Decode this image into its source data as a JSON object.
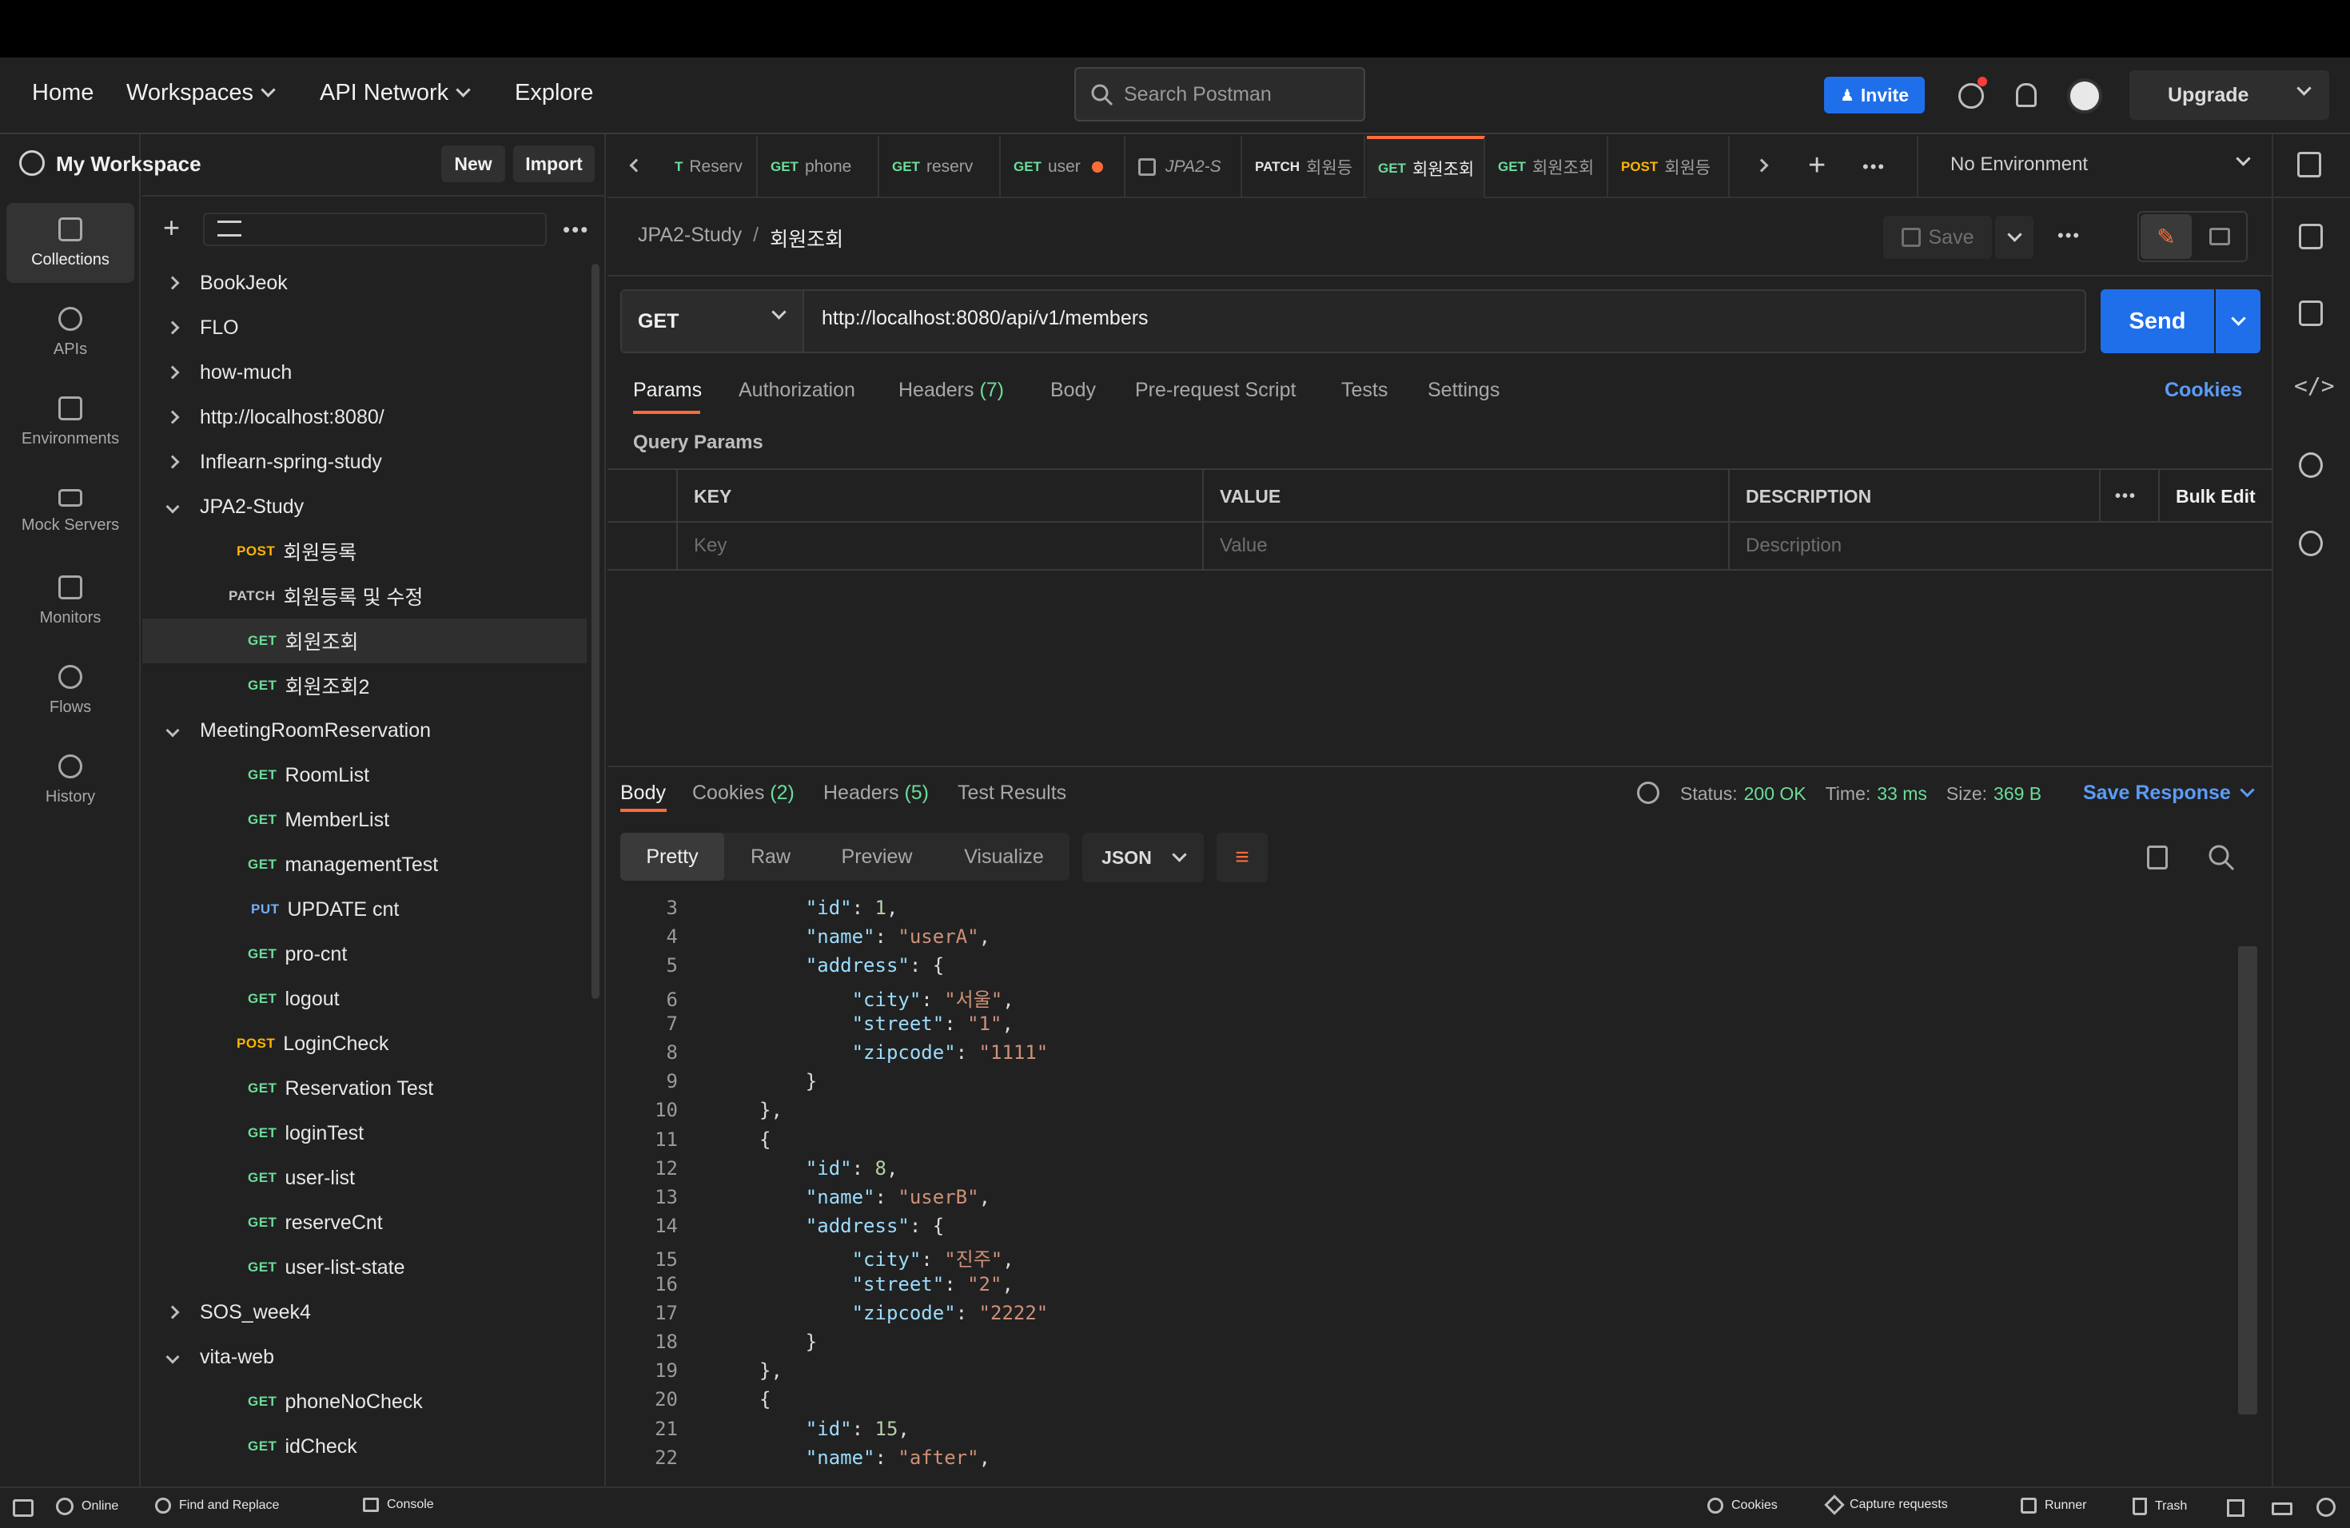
{
  "nav": {
    "home": "Home",
    "workspaces": "Workspaces",
    "api_network": "API Network",
    "explore": "Explore"
  },
  "search": {
    "placeholder": "Search Postman"
  },
  "header_actions": {
    "invite": "Invite",
    "upgrade": "Upgrade"
  },
  "workspace": {
    "name": "My Workspace",
    "new": "New",
    "import": "Import"
  },
  "rail": [
    "Collections",
    "APIs",
    "Environments",
    "Mock Servers",
    "Monitors",
    "Flows",
    "History"
  ],
  "tree": [
    {
      "label": "BookJeok",
      "type": "folder"
    },
    {
      "label": "FLO",
      "type": "folder"
    },
    {
      "label": "how-much",
      "type": "folder"
    },
    {
      "label": "http://localhost:8080/",
      "type": "folder"
    },
    {
      "label": "Inflearn-spring-study",
      "type": "folder"
    },
    {
      "label": "JPA2-Study",
      "type": "folder-open"
    },
    {
      "label": "회원등록",
      "method": "POST"
    },
    {
      "label": "회원등록 및 수정",
      "method": "PATCH"
    },
    {
      "label": "회원조회",
      "method": "GET",
      "selected": true
    },
    {
      "label": "회원조회2",
      "method": "GET"
    },
    {
      "label": "MeetingRoomReservation",
      "type": "folder-open"
    },
    {
      "label": "RoomList",
      "method": "GET"
    },
    {
      "label": "MemberList",
      "method": "GET"
    },
    {
      "label": "managementTest",
      "method": "GET"
    },
    {
      "label": "UPDATE cnt",
      "method": "PUT"
    },
    {
      "label": "pro-cnt",
      "method": "GET"
    },
    {
      "label": "logout",
      "method": "GET"
    },
    {
      "label": "LoginCheck",
      "method": "POST"
    },
    {
      "label": "Reservation Test",
      "method": "GET"
    },
    {
      "label": "loginTest",
      "method": "GET"
    },
    {
      "label": "user-list",
      "method": "GET"
    },
    {
      "label": "reserveCnt",
      "method": "GET"
    },
    {
      "label": "user-list-state",
      "method": "GET"
    },
    {
      "label": "SOS_week4",
      "type": "folder"
    },
    {
      "label": "vita-web",
      "type": "folder-open"
    },
    {
      "label": "phoneNoCheck",
      "method": "GET"
    },
    {
      "label": "idCheck",
      "method": "GET"
    }
  ],
  "tabs": [
    {
      "method": "T",
      "label": "Reserv"
    },
    {
      "method": "GET",
      "label": "phone"
    },
    {
      "method": "GET",
      "label": "reserv"
    },
    {
      "method": "GET",
      "label": "user"
    },
    {
      "method": "",
      "label": "JPA2-S"
    },
    {
      "method": "PATCH",
      "label": "회원등"
    },
    {
      "method": "GET",
      "label": "회원조회"
    },
    {
      "method": "GET",
      "label": "회원조회"
    },
    {
      "method": "POST",
      "label": "회원등"
    }
  ],
  "environment": "No Environment",
  "breadcrumb": {
    "collection": "JPA2-Study",
    "sep": "/",
    "request": "회원조회"
  },
  "save": "Save",
  "request": {
    "method": "GET",
    "url": "http://localhost:8080/api/v1/members",
    "send": "Send"
  },
  "req_tabs": {
    "params": "Params",
    "authorization": "Authorization",
    "headers": "Headers",
    "headers_count": "(7)",
    "body": "Body",
    "prerequest": "Pre-request Script",
    "tests": "Tests",
    "settings": "Settings",
    "cookies": "Cookies"
  },
  "query_params": {
    "title": "Query Params",
    "key": "KEY",
    "value": "VALUE",
    "description": "DESCRIPTION",
    "bulk_edit": "Bulk Edit",
    "key_ph": "Key",
    "value_ph": "Value",
    "desc_ph": "Description"
  },
  "response": {
    "tabs": {
      "body": "Body",
      "cookies": "Cookies",
      "cookies_count": "(2)",
      "headers": "Headers",
      "headers_count": "(5)",
      "test_results": "Test Results"
    },
    "status_label": "Status:",
    "status": "200 OK",
    "time_label": "Time:",
    "time": "33 ms",
    "size_label": "Size:",
    "size": "369 B",
    "save_response": "Save Response",
    "views": {
      "pretty": "Pretty",
      "raw": "Raw",
      "preview": "Preview",
      "visualize": "Visualize",
      "format": "JSON"
    }
  },
  "code": [
    {
      "n": "3",
      "indent": "    ",
      "k": "\"id\"",
      "v": "1",
      "vt": "n",
      "tail": ","
    },
    {
      "n": "4",
      "indent": "    ",
      "k": "\"name\"",
      "v": "\"userA\"",
      "vt": "s",
      "tail": ","
    },
    {
      "n": "5",
      "indent": "    ",
      "k": "\"address\"",
      "v": "{",
      "vt": "p",
      "tail": ""
    },
    {
      "n": "6",
      "indent": "        ",
      "k": "\"city\"",
      "v": "\"서울\"",
      "vt": "s",
      "tail": ","
    },
    {
      "n": "7",
      "indent": "        ",
      "k": "\"street\"",
      "v": "\"1\"",
      "vt": "s",
      "tail": ","
    },
    {
      "n": "8",
      "indent": "        ",
      "k": "\"zipcode\"",
      "v": "\"1111\"",
      "vt": "s",
      "tail": ""
    },
    {
      "n": "9",
      "indent": "    ",
      "k": "",
      "v": "}",
      "vt": "p",
      "tail": ""
    },
    {
      "n": "10",
      "indent": "",
      "k": "",
      "v": "},",
      "vt": "p",
      "tail": ""
    },
    {
      "n": "11",
      "indent": "",
      "k": "",
      "v": "{",
      "vt": "p",
      "tail": ""
    },
    {
      "n": "12",
      "indent": "    ",
      "k": "\"id\"",
      "v": "8",
      "vt": "n",
      "tail": ","
    },
    {
      "n": "13",
      "indent": "    ",
      "k": "\"name\"",
      "v": "\"userB\"",
      "vt": "s",
      "tail": ","
    },
    {
      "n": "14",
      "indent": "    ",
      "k": "\"address\"",
      "v": "{",
      "vt": "p",
      "tail": ""
    },
    {
      "n": "15",
      "indent": "        ",
      "k": "\"city\"",
      "v": "\"진주\"",
      "vt": "s",
      "tail": ","
    },
    {
      "n": "16",
      "indent": "        ",
      "k": "\"street\"",
      "v": "\"2\"",
      "vt": "s",
      "tail": ","
    },
    {
      "n": "17",
      "indent": "        ",
      "k": "\"zipcode\"",
      "v": "\"2222\"",
      "vt": "s",
      "tail": ""
    },
    {
      "n": "18",
      "indent": "    ",
      "k": "",
      "v": "}",
      "vt": "p",
      "tail": ""
    },
    {
      "n": "19",
      "indent": "",
      "k": "",
      "v": "},",
      "vt": "p",
      "tail": ""
    },
    {
      "n": "20",
      "indent": "",
      "k": "",
      "v": "{",
      "vt": "p",
      "tail": ""
    },
    {
      "n": "21",
      "indent": "    ",
      "k": "\"id\"",
      "v": "15",
      "vt": "n",
      "tail": ","
    },
    {
      "n": "22",
      "indent": "    ",
      "k": "\"name\"",
      "v": "\"after\"",
      "vt": "s",
      "tail": ","
    }
  ],
  "statusbar": {
    "online": "Online",
    "find_replace": "Find and Replace",
    "console": "Console",
    "cookies": "Cookies",
    "capture": "Capture requests",
    "runner": "Runner",
    "trash": "Trash"
  },
  "colors": {
    "accent": "#1f6feb",
    "orange": "#ff6c37",
    "get": "#6bdd9a",
    "post": "#ffb400",
    "put": "#74aef6",
    "status_ok": "#6bdd9a"
  }
}
